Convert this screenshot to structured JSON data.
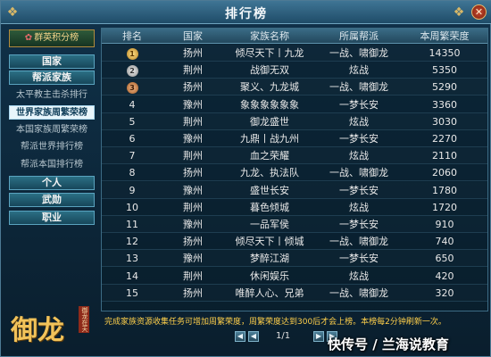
{
  "window": {
    "title": "排行榜",
    "close_glyph": "✕"
  },
  "left_panel": {
    "logo_text": "群英积分榜",
    "nav": [
      {
        "label": "国家",
        "type": "button"
      },
      {
        "label": "帮派家族",
        "type": "button"
      },
      {
        "label": "太平教主击杀排行",
        "type": "sub"
      },
      {
        "label": "世界家族周繁荣榜",
        "type": "sub",
        "active": true
      },
      {
        "label": "本国家族周繁荣榜",
        "type": "sub"
      },
      {
        "label": "帮派世界排行榜",
        "type": "sub"
      },
      {
        "label": "帮派本国排行榜",
        "type": "sub"
      },
      {
        "label": "个人",
        "type": "button"
      },
      {
        "label": "武勋",
        "type": "button"
      },
      {
        "label": "职业",
        "type": "button"
      }
    ],
    "emblem_text": "御龙",
    "emblem_stamp": "御龙在天"
  },
  "table": {
    "headers": [
      "排名",
      "国家",
      "家族名称",
      "所属帮派",
      "本周繁荣度"
    ],
    "rows": [
      {
        "rank": "1",
        "medal": "gold",
        "country": "扬州",
        "family": "倾尽天下丨九龙",
        "faction": "一战、啸御龙",
        "score": "14350"
      },
      {
        "rank": "2",
        "medal": "silver",
        "country": "荆州",
        "family": "战御无双",
        "faction": "炫战",
        "score": "5350"
      },
      {
        "rank": "3",
        "medal": "bronze",
        "country": "扬州",
        "family": "聚义、九龙城",
        "faction": "一战、啸御龙",
        "score": "5290"
      },
      {
        "rank": "4",
        "medal": "",
        "country": "豫州",
        "family": "象象象象象象",
        "faction": "一梦长安",
        "score": "3360"
      },
      {
        "rank": "5",
        "medal": "",
        "country": "荆州",
        "family": "御龙盛世",
        "faction": "炫战",
        "score": "3030"
      },
      {
        "rank": "6",
        "medal": "",
        "country": "豫州",
        "family": "九鼎丨战九州",
        "faction": "一梦长安",
        "score": "2270"
      },
      {
        "rank": "7",
        "medal": "",
        "country": "荆州",
        "family": "血之荣耀",
        "faction": "炫战",
        "score": "2110"
      },
      {
        "rank": "8",
        "medal": "",
        "country": "扬州",
        "family": "九龙、执法队",
        "faction": "一战、啸御龙",
        "score": "2060"
      },
      {
        "rank": "9",
        "medal": "",
        "country": "豫州",
        "family": "盛世长安",
        "faction": "一梦长安",
        "score": "1780"
      },
      {
        "rank": "10",
        "medal": "",
        "country": "荆州",
        "family": "暮色倾城",
        "faction": "炫战",
        "score": "1720"
      },
      {
        "rank": "11",
        "medal": "",
        "country": "豫州",
        "family": "一品军侯",
        "faction": "一梦长安",
        "score": "910"
      },
      {
        "rank": "12",
        "medal": "",
        "country": "扬州",
        "family": "倾尽天下丨倾城",
        "faction": "一战、啸御龙",
        "score": "740"
      },
      {
        "rank": "13",
        "medal": "",
        "country": "豫州",
        "family": "梦醉江湖",
        "faction": "一梦长安",
        "score": "650"
      },
      {
        "rank": "14",
        "medal": "",
        "country": "荆州",
        "family": "休闲娱乐",
        "faction": "炫战",
        "score": "420"
      },
      {
        "rank": "15",
        "medal": "",
        "country": "扬州",
        "family": "唯醉人心、兄弟",
        "faction": "一战、啸御龙",
        "score": "320"
      }
    ]
  },
  "notice": "完成家族资源收集任务可增加周繁荣度，周繁荣度达到300后才会上榜。本榜每2分钟刷新一次。",
  "pager": {
    "first": "◀",
    "prev": "◀",
    "text": "1/1",
    "next": "▶",
    "last": "▶"
  },
  "watermark": "快传号 / 兰海说教育"
}
